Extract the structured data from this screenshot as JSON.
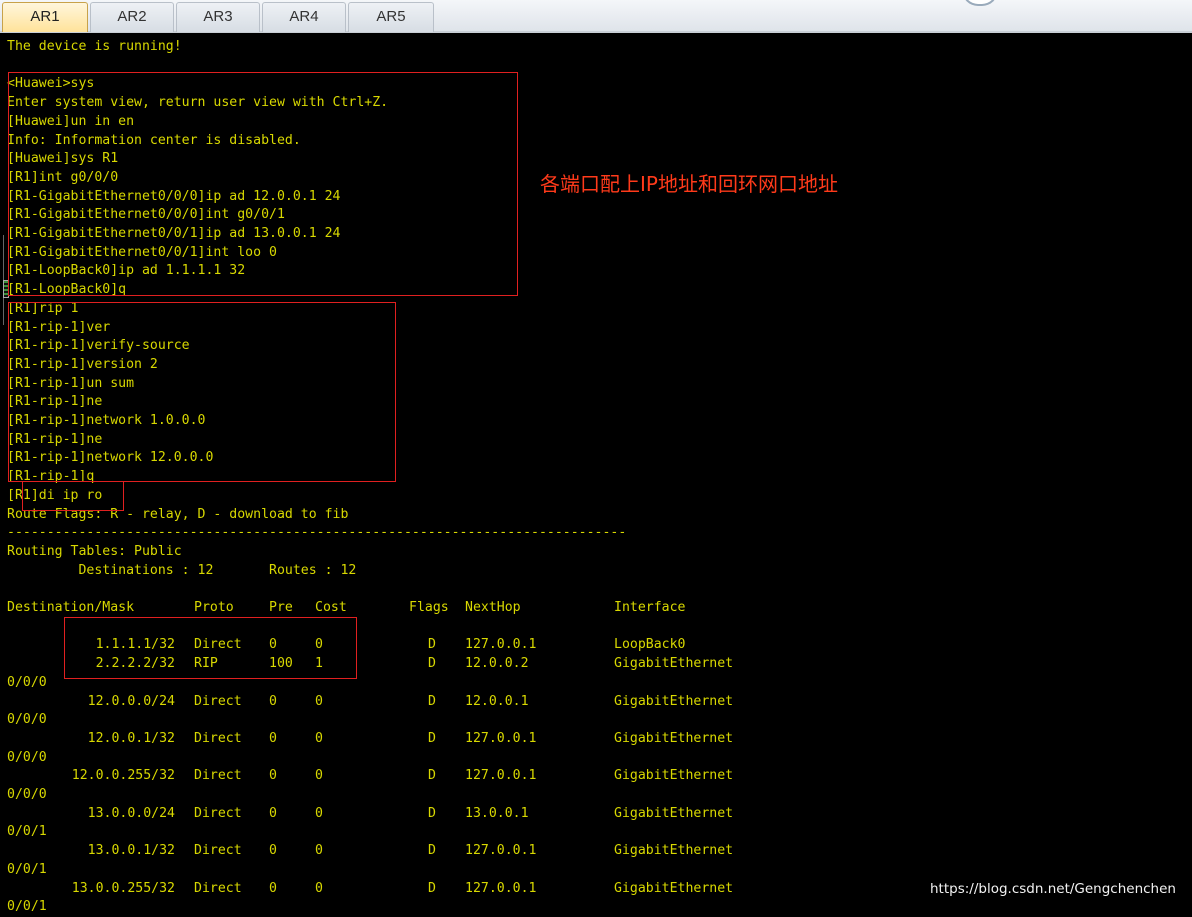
{
  "tabs": [
    {
      "label": "AR1",
      "active": true
    },
    {
      "label": "AR2",
      "active": false
    },
    {
      "label": "AR3",
      "active": false
    },
    {
      "label": "AR4",
      "active": false
    },
    {
      "label": "AR5",
      "active": false
    }
  ],
  "terminal": {
    "lines": [
      "The device is running!",
      "",
      "<Huawei>sys",
      "Enter system view, return user view with Ctrl+Z.",
      "[Huawei]un in en",
      "Info: Information center is disabled.",
      "[Huawei]sys R1",
      "[R1]int g0/0/0",
      "[R1-GigabitEthernet0/0/0]ip ad 12.0.0.1 24",
      "[R1-GigabitEthernet0/0/0]int g0/0/1",
      "[R1-GigabitEthernet0/0/1]ip ad 13.0.0.1 24",
      "[R1-GigabitEthernet0/0/1]int loo 0",
      "[R1-LoopBack0]ip ad 1.1.1.1 32",
      "[R1-LoopBack0]q",
      "[R1]rip 1",
      "[R1-rip-1]ver",
      "[R1-rip-1]verify-source",
      "[R1-rip-1]version 2",
      "[R1-rip-1]un sum",
      "[R1-rip-1]ne",
      "[R1-rip-1]network 1.0.0.0",
      "[R1-rip-1]ne",
      "[R1-rip-1]network 12.0.0.0",
      "[R1-rip-1]q",
      "[R1]di ip ro",
      "Route Flags: R - relay, D - download to fib",
      "------------------------------------------------------------------------------",
      "Routing Tables: Public",
      "         Destinations : 12       Routes : 12",
      ""
    ],
    "table_headers": {
      "destination": "Destination/Mask",
      "proto": "Proto",
      "pre": "Pre",
      "cost": "Cost",
      "flags": "Flags",
      "nexthop": "NextHop",
      "interface": "Interface"
    },
    "routes": [
      {
        "destination": "1.1.1.1/32",
        "proto": "Direct",
        "pre": "0",
        "cost": "0",
        "flags": "D",
        "nexthop": "127.0.0.1",
        "interface": "LoopBack0",
        "interface_cont": ""
      },
      {
        "destination": "2.2.2.2/32",
        "proto": "RIP",
        "pre": "100",
        "cost": "1",
        "flags": "D",
        "nexthop": "12.0.0.2",
        "interface": "GigabitEthernet",
        "interface_cont": "0/0/0"
      },
      {
        "destination": "12.0.0.0/24",
        "proto": "Direct",
        "pre": "0",
        "cost": "0",
        "flags": "D",
        "nexthop": "12.0.0.1",
        "interface": "GigabitEthernet",
        "interface_cont": "0/0/0"
      },
      {
        "destination": "12.0.0.1/32",
        "proto": "Direct",
        "pre": "0",
        "cost": "0",
        "flags": "D",
        "nexthop": "127.0.0.1",
        "interface": "GigabitEthernet",
        "interface_cont": "0/0/0"
      },
      {
        "destination": "12.0.0.255/32",
        "proto": "Direct",
        "pre": "0",
        "cost": "0",
        "flags": "D",
        "nexthop": "127.0.0.1",
        "interface": "GigabitEthernet",
        "interface_cont": "0/0/0"
      },
      {
        "destination": "13.0.0.0/24",
        "proto": "Direct",
        "pre": "0",
        "cost": "0",
        "flags": "D",
        "nexthop": "13.0.0.1",
        "interface": "GigabitEthernet",
        "interface_cont": "0/0/1"
      },
      {
        "destination": "13.0.0.1/32",
        "proto": "Direct",
        "pre": "0",
        "cost": "0",
        "flags": "D",
        "nexthop": "127.0.0.1",
        "interface": "GigabitEthernet",
        "interface_cont": "0/0/1"
      },
      {
        "destination": "13.0.0.255/32",
        "proto": "Direct",
        "pre": "0",
        "cost": "0",
        "flags": "D",
        "nexthop": "127.0.0.1",
        "interface": "GigabitEthernet",
        "interface_cont": "0/0/1"
      }
    ]
  },
  "annotation": "各端口配上IP地址和回环网口地址",
  "watermark": "https://blog.csdn.net/Gengchenchen",
  "colors": {
    "terminal_bg": "#000000",
    "terminal_text": "#d8d800",
    "highlight": "#e02020",
    "annotation": "#ff3a1a"
  }
}
